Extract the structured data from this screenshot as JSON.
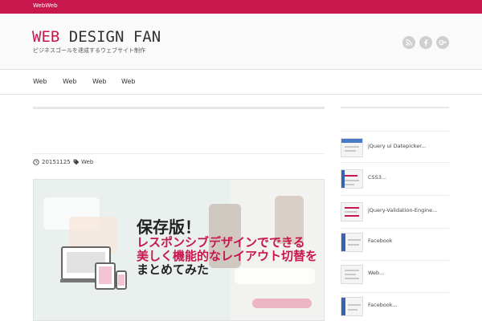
{
  "topbar": {
    "text": "WebWeb"
  },
  "header": {
    "logo_prefix": "WEB",
    "logo_rest": " DESIGN FAN",
    "tagline": "ビジネスゴールを達成するウェブサイト制作",
    "social": [
      "rss-icon",
      "facebook-icon",
      "google-plus-icon"
    ]
  },
  "nav": {
    "items": [
      "Web",
      "Web",
      "Web",
      "Web"
    ]
  },
  "article": {
    "date": "20151125",
    "category": "Web",
    "hero": {
      "line1": "保存版！",
      "line2": "レスポンシブデザインでできる",
      "line3": "美しく機能的なレイアウト切替を",
      "line4": "まとめてみた"
    }
  },
  "sidebar": {
    "items": [
      {
        "label": "jQuery ui Datepicker..."
      },
      {
        "label": "CSS3..."
      },
      {
        "label": "jQuery-Validation-Engine..."
      },
      {
        "label": "Facebook"
      },
      {
        "label": "Web..."
      },
      {
        "label": "Facebook..."
      }
    ]
  },
  "colors": {
    "accent": "#c8174c",
    "rule": "#e2e2e2",
    "social": "#cfcfcf"
  }
}
